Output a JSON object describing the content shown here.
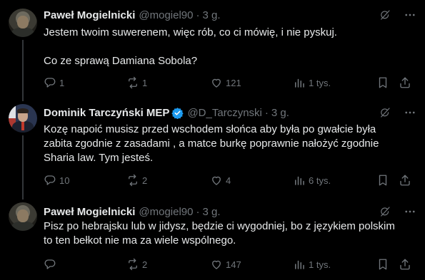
{
  "tweets": [
    {
      "author": "Paweł Mogielnicki",
      "handle": "@mogiel90",
      "time": "3 g.",
      "verified": false,
      "text": [
        "Jestem twoim suwerenem, więc rób, co ci mówię, i nie pyskuj.",
        "Co ze sprawą Damiana Sobola?"
      ],
      "replies": "1",
      "reposts": "1",
      "likes": "121",
      "views": "1 tys."
    },
    {
      "author": "Dominik Tarczyński MEP",
      "handle": "@D_Tarczynski",
      "time": "3 g.",
      "verified": true,
      "text": [
        "Kozę napoić musisz przed wschodem słońca aby była po gwałcie była",
        "zabita zgodnie z zasadami , a matce burkę poprawnie nałożyć zgodnie",
        "Sharia law. Tym jesteś."
      ],
      "replies": "10",
      "reposts": "2",
      "likes": "4",
      "views": "6 tys."
    },
    {
      "author": "Paweł Mogielnicki",
      "handle": "@mogiel90",
      "time": "3 g.",
      "verified": false,
      "text": [
        "Pisz po hebrajsku lub w jidysz, będzie ci wygodniej, bo z językiem polskim",
        "to ten bełkot nie ma za wiele wspólnego."
      ],
      "replies": "",
      "reposts": "2",
      "likes": "147",
      "views": "1 tys."
    }
  ],
  "separator": "·",
  "colors": {
    "background": "#000000",
    "text": "#e7e9ea",
    "muted": "#71767b",
    "verified": "#1d9bf0",
    "thread_line": "#333639"
  },
  "icons": [
    "grok-icon",
    "more-icon",
    "reply-icon",
    "repost-icon",
    "like-icon",
    "views-icon",
    "bookmark-icon",
    "share-icon",
    "verified-badge-icon"
  ]
}
